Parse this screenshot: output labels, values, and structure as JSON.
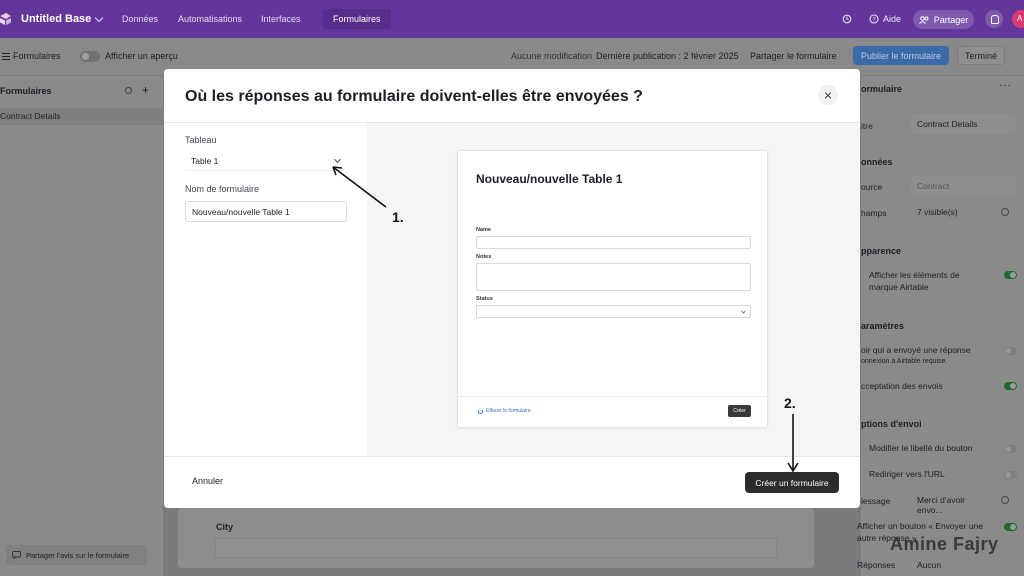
{
  "topbar": {
    "base_name": "Untitled Base",
    "nav": [
      "Données",
      "Automatisations",
      "Interfaces",
      "Formulaires"
    ],
    "active_nav": "Formulaires",
    "help": "Aide",
    "share": "Partager",
    "avatar_initial": "A",
    "accent": "#63369b"
  },
  "toolbar": {
    "forms_label": "Formulaires",
    "preview_label": "Afficher un aperçu",
    "no_changes": "Aucune modification",
    "last_published": "Dernière publication : 2 février 2025",
    "share_form": "Partager le formulaire",
    "publish": "Publier le formulaire",
    "done": "Terminé"
  },
  "sidebar": {
    "header": "Formulaires",
    "items": [
      {
        "label": "Contract Details"
      }
    ],
    "footer": "Partager l'avis sur le formulaire"
  },
  "right_panel": {
    "section_form": "ormulaire",
    "title_label": "itre",
    "title_value": "Contract Details",
    "section_data": "onnées",
    "source_label": "ource",
    "source_value": "Contract",
    "fields_label": "hamps",
    "fields_value": "7 visible(s)",
    "section_appearance": "pparence",
    "branding": "Afficher les éléments de marque Airtable",
    "section_settings": "aramètres",
    "see_who": "oir qui a envoyé une réponse",
    "see_who_sub": "onnexion à Airtable requise.",
    "accept": "cceptation des envois",
    "section_send": "ptions d'envoi",
    "modify_button": "Modifier le libellé du bouton",
    "redirect": "Rediriger vers l'URL",
    "message_label": "lessage",
    "message_value": "Merci d'avoir envo...",
    "show_button": "Afficher un bouton « Envoyer une autre réponse »",
    "responses_label": "Réponses",
    "responses_value": "Aucun"
  },
  "background_form": {
    "city_label": "City"
  },
  "modal": {
    "title": "Où les réponses au formulaire doivent-elles être envoyées ?",
    "table_label": "Tableau",
    "table_value": "Table 1",
    "form_name_label": "Nom de formulaire",
    "form_name_value": "Nouveau/nouvelle Table 1",
    "preview": {
      "title": "Nouveau/nouvelle Table 1",
      "fields": [
        "Name",
        "Notes",
        "Status"
      ],
      "clear": "Effacer le formulaire",
      "submit": "Créer"
    },
    "cancel": "Annuler",
    "create": "Créer un formulaire"
  },
  "annotations": {
    "step1": "1.",
    "step2": "2.",
    "watermark": "Amine Fajry"
  }
}
